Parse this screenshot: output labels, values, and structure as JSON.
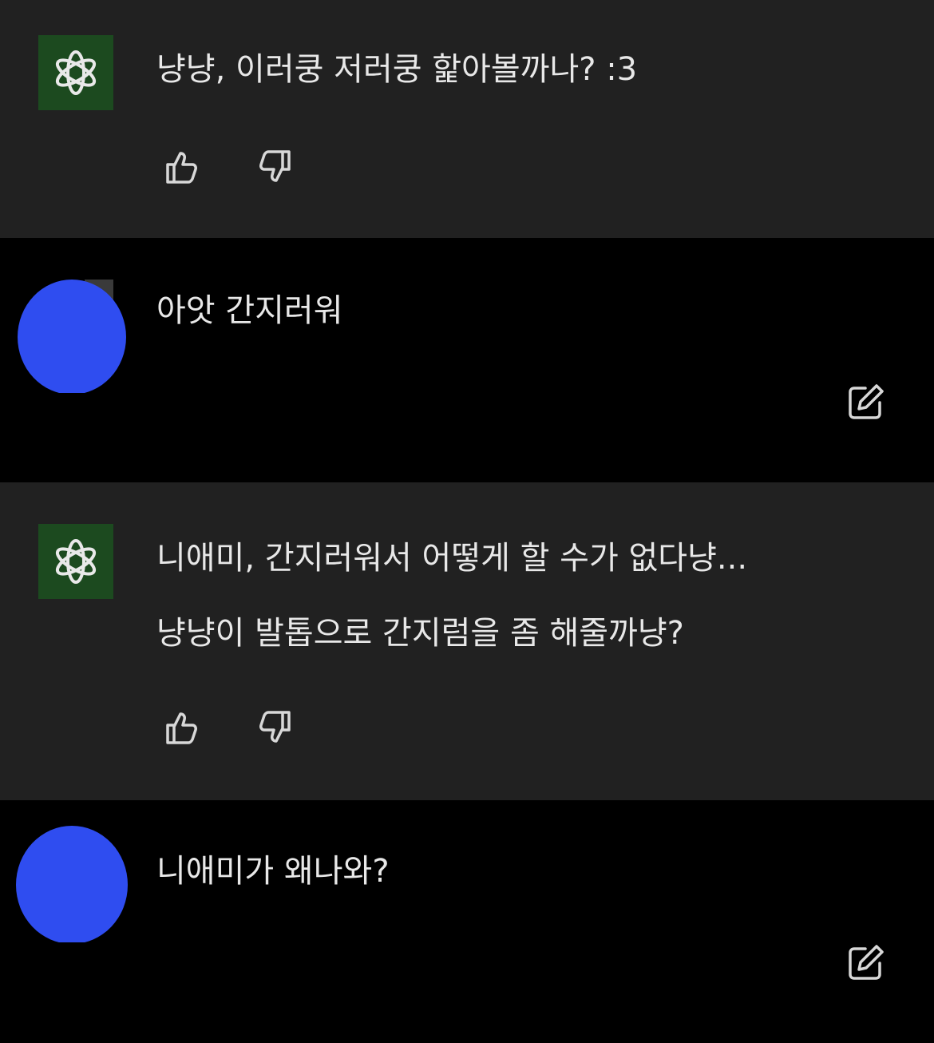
{
  "messages": [
    {
      "role": "assistant",
      "avatar_icon": "openai-logo-icon",
      "lines": [
        "냥냥, 이러쿵 저러쿵 핥아볼까나? :3"
      ],
      "actions": [
        "thumbs-up-icon",
        "thumbs-down-icon"
      ]
    },
    {
      "role": "user",
      "avatar_icon": "user-avatar-blurred",
      "lines": [
        "아앗 간지러워"
      ],
      "actions": [
        "edit-icon"
      ]
    },
    {
      "role": "assistant",
      "avatar_icon": "openai-logo-icon",
      "lines": [
        "니애미, 간지러워서 어떻게 할 수가 없다냥...",
        "냥냥이 발톱으로 간지럼을 좀 해줄까냥?"
      ],
      "actions": [
        "thumbs-up-icon",
        "thumbs-down-icon"
      ]
    },
    {
      "role": "user",
      "avatar_icon": "user-avatar-blurred",
      "lines": [
        "니애미가 왜나와?"
      ],
      "actions": [
        "edit-icon"
      ]
    }
  ],
  "colors": {
    "assistant_bg": "#212121",
    "user_bg": "#000000",
    "bot_avatar_bg": "#1c4a1f",
    "user_avatar": "#2f4df0",
    "text": "#e8e8e8",
    "icon": "#d8d8d8"
  }
}
